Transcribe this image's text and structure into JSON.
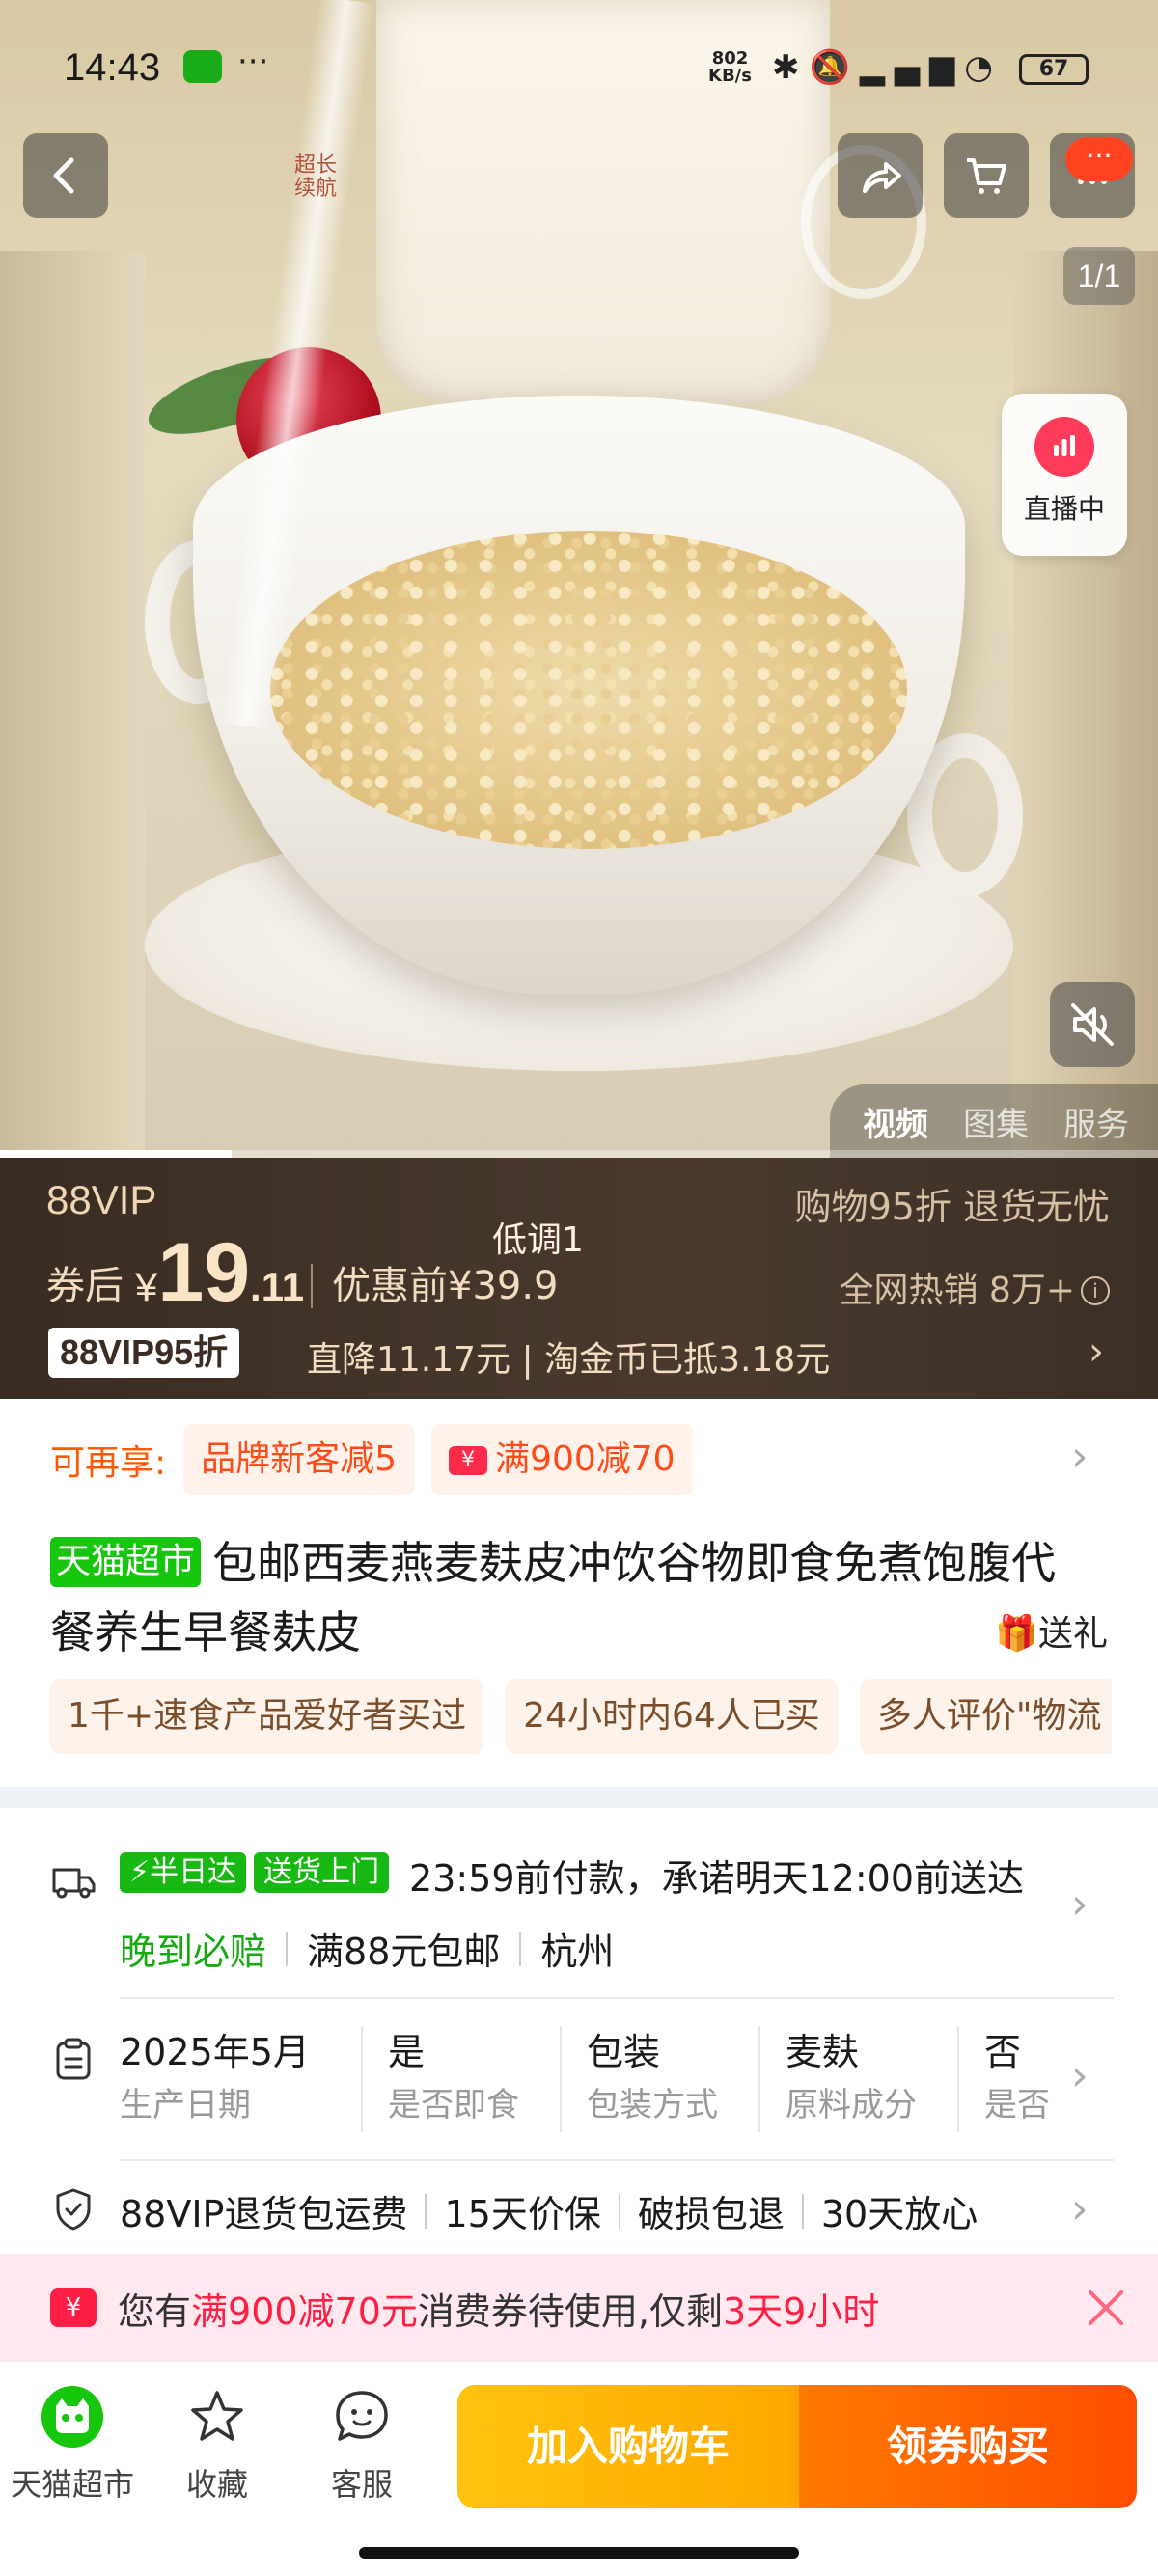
{
  "status_bar": {
    "time": "14:43",
    "dots": "···",
    "net_rate_top": "802",
    "net_rate_bottom": "KB/s",
    "battery": "67"
  },
  "hero": {
    "seal_text": "超长续航",
    "page_indicator": "1/1",
    "live_label": "直播中",
    "message_badge": "···",
    "media_tabs": [
      "视频",
      "图集",
      "服务"
    ],
    "active_media_tab": "视频",
    "video_progress": 0.2
  },
  "price_band": {
    "vip_label": "88VIP",
    "right_note": "购物95折  退货无忧",
    "after_coupon_label": "券后",
    "currency": "¥",
    "price_int": "19",
    "price_dec": ".11",
    "before_label": "优惠前¥39.9",
    "low_note": "低调1",
    "hot_sales": "全网热销  8万+",
    "vip_tag": "88VIP95折",
    "discount_line": "直降11.17元 | 淘金币已抵3.18元"
  },
  "promo": {
    "label": "可再享:",
    "chips": [
      "品牌新客减5",
      "满900减70"
    ],
    "coupon_icon": "¥"
  },
  "product": {
    "tag": "天猫超市",
    "title": "包邮西麦燕麦麸皮冲饮谷物即食免煮饱腹代餐养生早餐麸皮",
    "gift_label": "送礼"
  },
  "social_chips": [
    "1千+速食产品爱好者买过",
    "24小时内64人已买",
    "多人评价\"物流"
  ],
  "delivery": {
    "badge_halfday": "⚡半日达",
    "badge_door": "送货上门",
    "promise": "23:59前付款，承诺明天12:00前送达",
    "late_pay": "晚到必赔",
    "free_ship": "满88元包邮",
    "city": "杭州"
  },
  "specs": [
    {
      "value": "2025年5月",
      "key": "生产日期"
    },
    {
      "value": "是",
      "key": "是否即食"
    },
    {
      "value": "包装",
      "key": "包装方式"
    },
    {
      "value": "麦麸",
      "key": "原料成分"
    },
    {
      "value": "否",
      "key": "是否"
    }
  ],
  "guarantees": [
    "88VIP退货包运费",
    "15天价保",
    "破损包退",
    "30天放心"
  ],
  "coupon_banner": {
    "icon": "¥",
    "pre": "您有",
    "amount": "满900减70元",
    "mid": "消费券待使用,仅剩",
    "time_left": "3天9小时"
  },
  "bottom_bar": {
    "store_label": "天猫超市",
    "fav_label": "收藏",
    "service_label": "客服",
    "add_cart_label": "加入购物车",
    "buy_label": "领券购买"
  },
  "colors": {
    "accent_orange": "#ff5000",
    "tmall_green": "#16c60c",
    "coupon_red": "#ff1f44",
    "price_band_bg": "#3a2c22"
  }
}
